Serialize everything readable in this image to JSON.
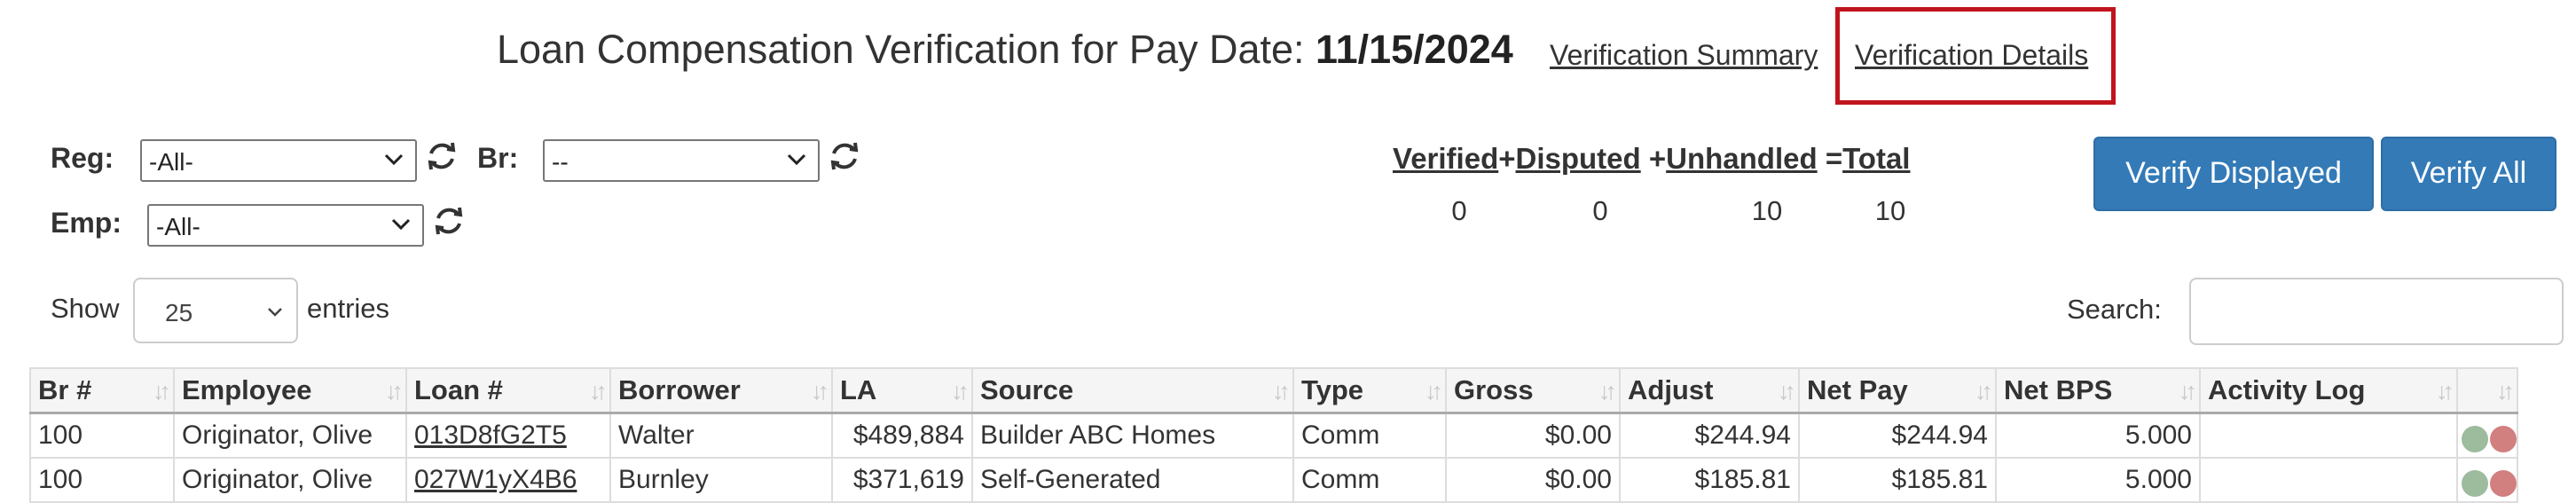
{
  "header": {
    "title_prefix": "Loan Compensation Verification for Pay Date:",
    "pay_date": "11/15/2024",
    "link_summary": "Verification Summary",
    "link_details": "Verification Details"
  },
  "filters": {
    "reg_label": "Reg:",
    "reg_value": "-All-",
    "br_label": "Br:",
    "br_value": "--",
    "emp_label": "Emp:",
    "emp_value": "-All-"
  },
  "counts": {
    "verified_label": "Verified",
    "plus1": "+",
    "disputed_label": "Disputed",
    "plus2": "+",
    "unhandled_label": "Unhandled",
    "eq": "=",
    "total_label": "Total",
    "verified": "0",
    "disputed": "0",
    "unhandled": "10",
    "total": "10"
  },
  "buttons": {
    "verify_displayed": "Verify Displayed",
    "verify_all": "Verify All"
  },
  "length": {
    "show": "Show",
    "value": "25",
    "entries": "entries"
  },
  "search": {
    "label": "Search:",
    "value": ""
  },
  "table": {
    "columns": [
      "Br #",
      "Employee",
      "Loan #",
      "Borrower",
      "LA",
      "Source",
      "Type",
      "Gross",
      "Adjust",
      "Net Pay",
      "Net BPS",
      "Activity Log",
      ""
    ],
    "rows": [
      {
        "br": "100",
        "employee": "Originator, Olive",
        "loan": "013D8fG2T5",
        "borrower": "Walter",
        "la": "$489,884",
        "source": "Builder ABC Homes",
        "type": "Comm",
        "gross": "$0.00",
        "adjust": "$244.94",
        "net_pay": "$244.94",
        "net_bps": "5.000",
        "activity": ""
      },
      {
        "br": "100",
        "employee": "Originator, Olive",
        "loan": "027W1yX4B6",
        "borrower": "Burnley",
        "la": "$371,619",
        "source": "Self-Generated",
        "type": "Comm",
        "gross": "$0.00",
        "adjust": "$185.81",
        "net_pay": "$185.81",
        "net_bps": "5.000",
        "activity": ""
      }
    ]
  },
  "colors": {
    "primary": "#337ab7",
    "highlight": "#c0151d",
    "approve": "#9dbb9d",
    "reject": "#d27f7f"
  },
  "icons": [
    "chevron-down-icon",
    "refresh-icon",
    "sort-icon",
    "approve-icon",
    "reject-icon"
  ]
}
